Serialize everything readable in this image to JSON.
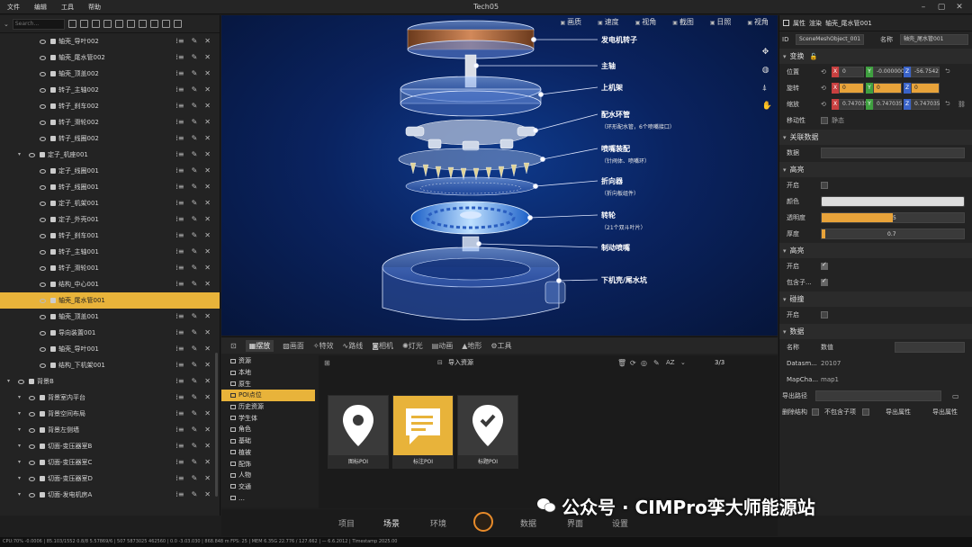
{
  "titlebar": {
    "menu": [
      "文件",
      "编辑",
      "工具",
      "帮助"
    ],
    "title": "Tech05"
  },
  "search": {
    "placeholder": "Search..."
  },
  "tree": [
    {
      "label": "轴壳_导叶002",
      "indent": 3
    },
    {
      "label": "轴壳_尾水管002",
      "indent": 3
    },
    {
      "label": "轴壳_顶盖002",
      "indent": 3
    },
    {
      "label": "转子_主轴002",
      "indent": 3
    },
    {
      "label": "转子_刹车002",
      "indent": 3
    },
    {
      "label": "转子_滑轮002",
      "indent": 3
    },
    {
      "label": "转子_线圈002",
      "indent": 3
    },
    {
      "label": "定子_机座001",
      "indent": 2
    },
    {
      "label": "定子_线圈001",
      "indent": 3
    },
    {
      "label": "转子_线圈001",
      "indent": 3
    },
    {
      "label": "定子_机架001",
      "indent": 3
    },
    {
      "label": "定子_外壳001",
      "indent": 3
    },
    {
      "label": "转子_刹车001",
      "indent": 3
    },
    {
      "label": "转子_主轴001",
      "indent": 3
    },
    {
      "label": "转子_滑轮001",
      "indent": 3
    },
    {
      "label": "结构_中心001",
      "indent": 3
    },
    {
      "label": "轴壳_尾水管001",
      "indent": 3,
      "selected": true
    },
    {
      "label": "轴壳_顶盖001",
      "indent": 3
    },
    {
      "label": "导向装置001",
      "indent": 3
    },
    {
      "label": "轴壳_导叶001",
      "indent": 3
    },
    {
      "label": "结构_下机架001",
      "indent": 3
    },
    {
      "label": "背景B",
      "indent": 1
    },
    {
      "label": "背景室内平台",
      "indent": 2
    },
    {
      "label": "背景空间布局",
      "indent": 2
    },
    {
      "label": "背景左侧墙",
      "indent": 2
    },
    {
      "label": "切面-变压器室B",
      "indent": 2
    },
    {
      "label": "切面-变压器室C",
      "indent": 2
    },
    {
      "label": "切面-变压器室D",
      "indent": 2
    },
    {
      "label": "切面-发电机房A",
      "indent": 2
    }
  ],
  "viewport": {
    "tabs": [
      "画质",
      "速度",
      "视角",
      "截图",
      "日照",
      "视角"
    ],
    "callouts": [
      {
        "title": "发电机转子",
        "sub": ""
      },
      {
        "title": "主轴",
        "sub": ""
      },
      {
        "title": "上机架",
        "sub": ""
      },
      {
        "title": "配水环管",
        "sub": "（环形配水管，6个喷嘴接口）"
      },
      {
        "title": "喷嘴装配",
        "sub": "（针阀体、喷嘴环）"
      },
      {
        "title": "折向器",
        "sub": "（折向板组件）"
      },
      {
        "title": "转轮",
        "sub": "（21个双斗叶片）"
      },
      {
        "title": "制动喷嘴",
        "sub": ""
      },
      {
        "title": "下机壳/尾水坑",
        "sub": ""
      }
    ]
  },
  "properties": {
    "header_tab": "属性",
    "header_type": "渲染",
    "header_name": "轴壳_尾水管001",
    "id_label": "ID",
    "id_value": "SceneMeshObject_001",
    "name_label": "名称",
    "name_value": "轴壳_尾水管001",
    "transform_title": "变换",
    "pos_label": "位置",
    "pos_x": "0",
    "pos_y": "-0.000000",
    "pos_z": "-56.7542",
    "rot_label": "旋转",
    "rot_x": "0",
    "rot_y": "0",
    "rot_z": "0",
    "scale_label": "缩放",
    "scale_x": "0.747035",
    "scale_y": "0.747035",
    "scale_z": "0.747035",
    "move_label": "移动性",
    "move_value": "静态",
    "link_title": "关联数据",
    "link_label": "数据",
    "mat_title": "高亮",
    "mat_enable": "开启",
    "mat_color": "颜色",
    "mat_opacity": "透明度",
    "mat_opacity_val": "5",
    "mat_thick": "厚度",
    "mat_thick_val": "0.7",
    "hl_title": "高亮",
    "hl_enable": "开启",
    "hl_include": "包含子...",
    "coll_title": "碰撞",
    "coll_enable": "开启",
    "data_title": "数据",
    "data_name_label": "名称",
    "data_name_value": "数值",
    "data_k1": "Datasm...",
    "data_v1": "20107",
    "data_k2": "MapCha...",
    "data_v2": "map1",
    "export_label": "导出路径",
    "export_opts": [
      "删除结构",
      "不包含子项",
      "导出属性",
      "导出属性"
    ]
  },
  "resources": {
    "tabs": [
      "摆放",
      "画面",
      "特效",
      "路线",
      "相机",
      "灯光",
      "动画",
      "地形",
      "工具"
    ],
    "categories": [
      "资源",
      "本地",
      "原生",
      "POI点位",
      "历史资源",
      "学生体",
      "角色",
      "基础",
      "植被",
      "配饰",
      "人物",
      "交通",
      "…"
    ],
    "selected_category": 3,
    "import_label": "导入资源",
    "page": "3/3",
    "cards": [
      "图标POI",
      "标注POI",
      "标题POI"
    ]
  },
  "bottomnav": [
    "项目",
    "场景",
    "环境",
    "数据",
    "界面",
    "设置"
  ],
  "statusbar": "CPU:70% -0.0006 | 85.103/1552 0.8/8 5.57869/6 | 507 5873025 462560 | 0.0 -3.03.030 | 868.848 m FPS: 25 | MEM 6.35G 22.776 / 127.662 | — 6.6.2012 | Timestamp 2025.00",
  "watermark": "公众号 · CIMPro孪大师能源站"
}
